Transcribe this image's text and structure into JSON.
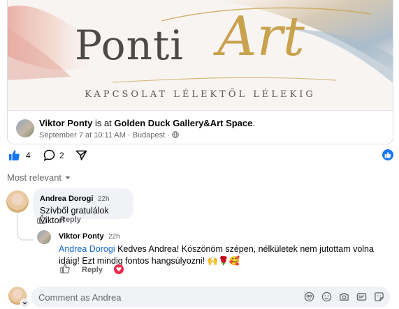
{
  "post": {
    "brand": {
      "ponti": "Ponti",
      "art": "Art",
      "tagline": "KAPCSOLAT LÉLEKTŐL LÉLEKIG"
    },
    "checkin": {
      "author": "Viktor Ponty",
      "is_at": " is at ",
      "place": "Golden Duck Gallery&Art Space",
      "period": ".",
      "date": "September 7 at 10:11 AM",
      "separator": " · ",
      "city": "Budapest",
      "separator2": " · ",
      "privacy_icon": "globe-icon"
    },
    "actions": {
      "like_count": "4",
      "comment_count": "2"
    }
  },
  "sort": {
    "label": "Most relevant"
  },
  "comments": [
    {
      "author": "Andrea Dorogi",
      "time": "22h",
      "text": "Szívből gratulálok Viktor!",
      "reply_label": "Reply"
    },
    {
      "author": "Viktor Ponty",
      "time": "22h",
      "mention": "Andrea Dorogi",
      "text_line1": " Kedves Andrea! Köszönöm szépen, nélkületek nem jutottam volna",
      "text_line2": "idáig! Ezt mindig fontos hangsúlyozni! ",
      "emojis": "🙌🌹🥰",
      "reply_label": "Reply"
    }
  ],
  "composer": {
    "placeholder": "Comment as Andrea"
  },
  "colors": {
    "accent": "#1877f2",
    "reaction_love": "#f02849",
    "art_gold": "#c9a24d"
  }
}
